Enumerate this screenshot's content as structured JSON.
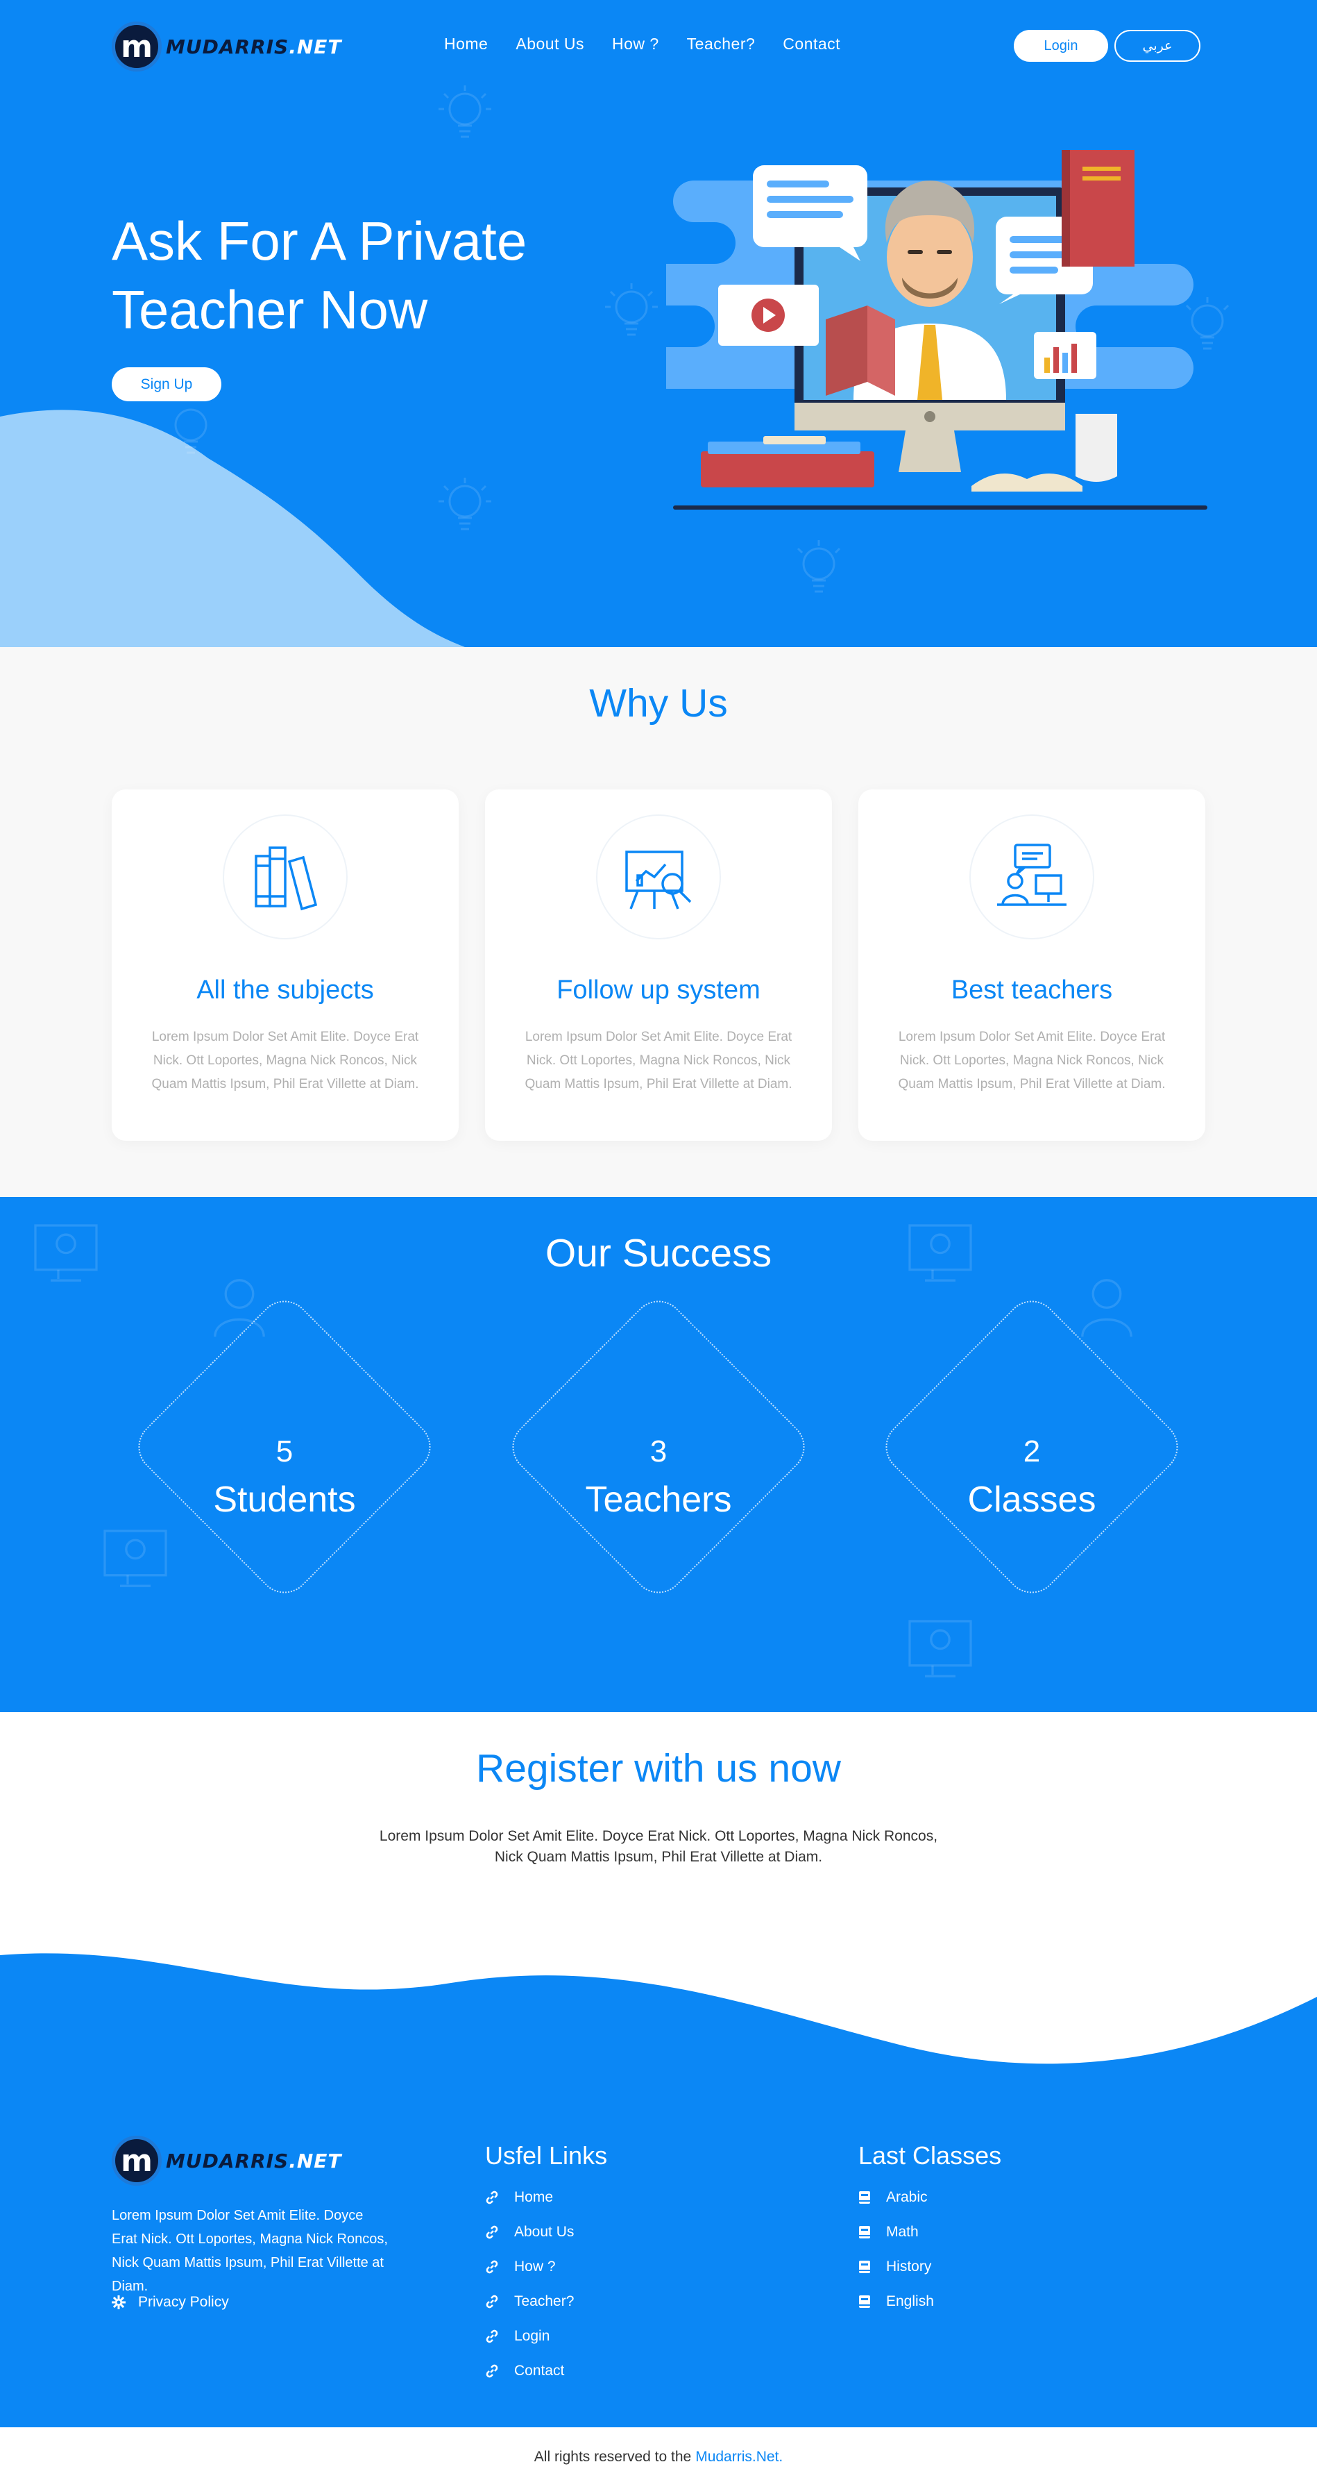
{
  "brand": {
    "name_main": "MUDARRIS",
    "name_suffix": ".NET",
    "badge_letter": "m"
  },
  "nav": {
    "links": [
      "Home",
      "About Us",
      "How ?",
      "Teacher?",
      "Contact"
    ],
    "login_label": "Login",
    "language_label": "عربي"
  },
  "hero": {
    "title_line1": "Ask For A Private",
    "title_line2": "Teacher Now",
    "signup_label": "Sign Up"
  },
  "why_us": {
    "title": "Why Us",
    "cards": [
      {
        "title": "All the subjects",
        "text": "Lorem Ipsum Dolor Set Amit Elite. Doyce Erat Nick. Ott Loportes, Magna Nick Roncos, Nick Quam Mattis Ipsum, Phil Erat Villette at Diam.",
        "icon": "books-icon"
      },
      {
        "title": "Follow up system",
        "text": "Lorem Ipsum Dolor Set Amit Elite. Doyce Erat Nick. Ott Loportes, Magna Nick Roncos, Nick Quam Mattis Ipsum, Phil Erat Villette at Diam.",
        "icon": "chart-magnifier-icon"
      },
      {
        "title": "Best teachers",
        "text": "Lorem Ipsum Dolor Set Amit Elite. Doyce Erat Nick. Ott Loportes, Magna Nick Roncos, Nick Quam Mattis Ipsum, Phil Erat Villette at Diam.",
        "icon": "teacher-desk-icon"
      }
    ]
  },
  "success": {
    "title": "Our Success",
    "stats": [
      {
        "number": "5",
        "label": "Students"
      },
      {
        "number": "3",
        "label": "Teachers"
      },
      {
        "number": "2",
        "label": "Classes"
      }
    ]
  },
  "register": {
    "title": "Register with us now",
    "text": "Lorem Ipsum Dolor Set Amit Elite. Doyce Erat Nick. Ott Loportes, Magna Nick Roncos, Nick Quam Mattis Ipsum, Phil Erat Villette at Diam."
  },
  "footer": {
    "description": "Lorem Ipsum Dolor Set Amit Elite. Doyce Erat Nick. Ott Loportes, Magna Nick Roncos, Nick Quam Mattis Ipsum, Phil Erat Villette at Diam.",
    "privacy_label": "Privacy Policy",
    "links_title": "Usfel Links",
    "links": [
      "Home",
      "About Us",
      "How ?",
      "Teacher?",
      "Login",
      "Contact"
    ],
    "classes_title": "Last Classes",
    "classes": [
      "Arabic",
      "Math",
      "History",
      "English"
    ],
    "copyright_text": "All rights reserved to the",
    "copyright_brand": "Mudarris.Net."
  },
  "colors": {
    "primary": "#0b87f5",
    "light_wave": "#9bd0fb",
    "dark_navy": "#0a1b3d",
    "muted_text": "#b0b0b0"
  }
}
